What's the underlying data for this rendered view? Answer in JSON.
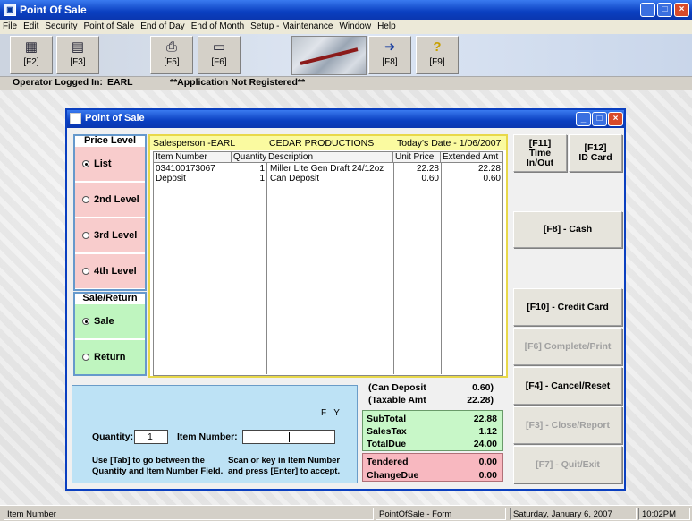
{
  "app": {
    "title": "Point Of Sale"
  },
  "menu": [
    "File",
    "Edit",
    "Security",
    "Point of Sale",
    "End of Day",
    "End of Month",
    "Setup - Maintenance",
    "Window",
    "Help"
  ],
  "toolbar": {
    "buttons": [
      {
        "key": "[F2]",
        "icon": "calculator-icon"
      },
      {
        "key": "[F3]",
        "icon": "keypad-icon"
      },
      {
        "key": "[F5]",
        "icon": "printer-icon"
      },
      {
        "key": "[F6]",
        "icon": "register-icon"
      },
      {
        "key": "[F8]",
        "icon": "exit-door-icon"
      },
      {
        "key": "[F9]",
        "icon": "help-question-icon"
      }
    ]
  },
  "operator": {
    "label": "Operator Logged In:",
    "name": "EARL",
    "registration": "**Application Not Registered**"
  },
  "pos_window": {
    "title": "Point of Sale"
  },
  "price_level": {
    "title": "Price Level",
    "options": [
      "List",
      "2nd Level",
      "3rd Level",
      "4th Level"
    ],
    "selected": "List"
  },
  "sale_return": {
    "title": "Sale/Return",
    "options": [
      "Sale",
      "Return"
    ],
    "selected": "Sale"
  },
  "receipt": {
    "salesperson": "Salesperson -EARL",
    "customer": "CEDAR PRODUCTIONS",
    "date": "Today's Date -  1/06/2007",
    "columns": [
      "Item Number",
      "Quantity",
      "Description",
      "Unit Price",
      "Extended Amt"
    ],
    "rows": [
      {
        "item": "034100173067",
        "qty": "1",
        "desc": "Miller Lite Gen Draft 24/12oz",
        "price": "22.28",
        "ext": "22.28"
      },
      {
        "item": "Deposit",
        "qty": "1",
        "desc": "Can Deposit",
        "price": "0.60",
        "ext": "0.60"
      }
    ]
  },
  "actions": {
    "f11": [
      "[F11]",
      "Time",
      "In/Out"
    ],
    "f12": [
      "[F12]",
      "ID Card"
    ],
    "cash": "[F8] - Cash",
    "credit": "[F10] - Credit Card",
    "complete": "[F6] Complete/Print",
    "cancel": "[F4] - Cancel/Reset",
    "close": "[F3] - Close/Report",
    "quit": "[F7] - Quit/Exit"
  },
  "entry": {
    "fy": "F   Y",
    "quantity_label": "Quantity:",
    "quantity_value": "1",
    "item_label": "Item Number:",
    "item_value": "",
    "hint_left": "Use [Tab] to go between the Quantity and Item Number Field.",
    "hint_right": "Scan or key in Item Number and press [Enter] to accept."
  },
  "totals": {
    "can_deposit_label": "(Can Deposit",
    "can_deposit_value": "0.60)",
    "taxable_label": "(Taxable Amt",
    "taxable_value": "22.28)",
    "subtotal_label": "SubTotal",
    "subtotal_value": "22.88",
    "salestax_label": "SalesTax",
    "salestax_value": "1.12",
    "totaldue_label": "TotalDue",
    "totaldue_value": "24.00",
    "tendered_label": "Tendered",
    "tendered_value": "0.00",
    "changedue_label": "ChangeDue",
    "changedue_value": "0.00"
  },
  "statusbar": {
    "field": "Item Number",
    "form": "PointOfSale - Form",
    "date": "Saturday, January  6, 2007",
    "time": "10:02PM"
  }
}
